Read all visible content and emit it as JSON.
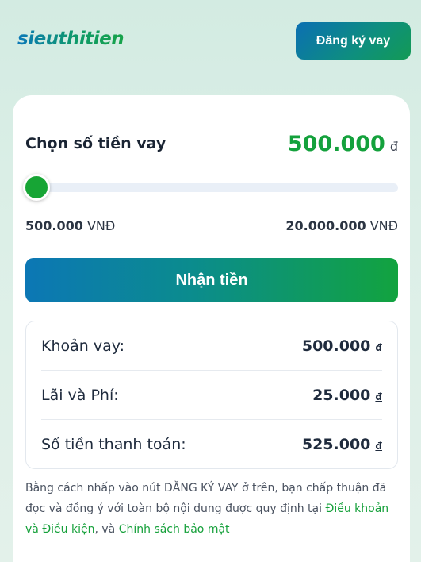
{
  "header": {
    "logo_text": "sieuthitien",
    "register_label": "Đăng ký vay"
  },
  "loan": {
    "title": "Chọn số tiền vay",
    "amount": "500.000",
    "amount_unit": "đ",
    "slider_value_fraction": 0.0,
    "min_amount": "500.000",
    "max_amount": "20.000.000",
    "range_unit": "VNĐ",
    "submit_label": "Nhận tiền"
  },
  "summary": {
    "rows": [
      {
        "label": "Khoản vay:",
        "value": "500.000",
        "currency": "đ"
      },
      {
        "label": "Lãi và Phí:",
        "value": "25.000",
        "currency": "đ"
      },
      {
        "label": "Số tiền thanh toán:",
        "value": "525.000",
        "currency": "đ"
      }
    ]
  },
  "terms": {
    "text_before": "Bằng cách nhấp vào nút ĐĂNG KÝ VAY ở trên, bạn chấp thuận đã đọc và đồng ý với toàn bộ nội dung được quy định tại ",
    "link_terms": "Điều khoản và Điều kiện",
    "text_middle": ", và ",
    "link_privacy": "Chính sách bảo mật"
  },
  "colors": {
    "accent_green": "#14a13c",
    "accent_blue": "#0b6fb3"
  }
}
